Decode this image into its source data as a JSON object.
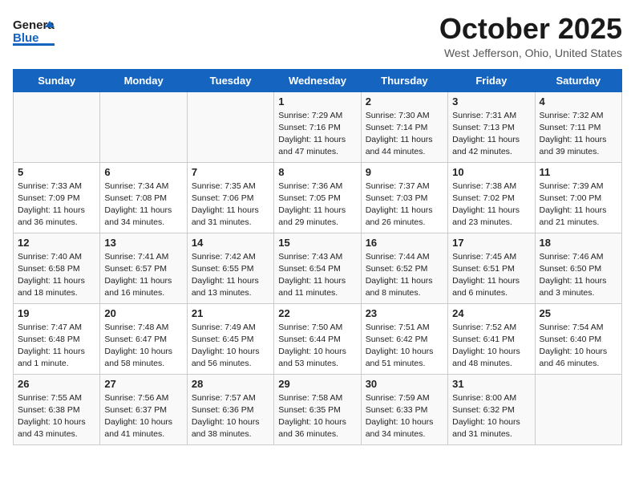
{
  "header": {
    "logo_line1": "General",
    "logo_line2": "Blue",
    "month": "October 2025",
    "location": "West Jefferson, Ohio, United States"
  },
  "days_of_week": [
    "Sunday",
    "Monday",
    "Tuesday",
    "Wednesday",
    "Thursday",
    "Friday",
    "Saturday"
  ],
  "weeks": [
    [
      {
        "day": "",
        "detail": ""
      },
      {
        "day": "",
        "detail": ""
      },
      {
        "day": "",
        "detail": ""
      },
      {
        "day": "1",
        "detail": "Sunrise: 7:29 AM\nSunset: 7:16 PM\nDaylight: 11 hours\nand 47 minutes."
      },
      {
        "day": "2",
        "detail": "Sunrise: 7:30 AM\nSunset: 7:14 PM\nDaylight: 11 hours\nand 44 minutes."
      },
      {
        "day": "3",
        "detail": "Sunrise: 7:31 AM\nSunset: 7:13 PM\nDaylight: 11 hours\nand 42 minutes."
      },
      {
        "day": "4",
        "detail": "Sunrise: 7:32 AM\nSunset: 7:11 PM\nDaylight: 11 hours\nand 39 minutes."
      }
    ],
    [
      {
        "day": "5",
        "detail": "Sunrise: 7:33 AM\nSunset: 7:09 PM\nDaylight: 11 hours\nand 36 minutes."
      },
      {
        "day": "6",
        "detail": "Sunrise: 7:34 AM\nSunset: 7:08 PM\nDaylight: 11 hours\nand 34 minutes."
      },
      {
        "day": "7",
        "detail": "Sunrise: 7:35 AM\nSunset: 7:06 PM\nDaylight: 11 hours\nand 31 minutes."
      },
      {
        "day": "8",
        "detail": "Sunrise: 7:36 AM\nSunset: 7:05 PM\nDaylight: 11 hours\nand 29 minutes."
      },
      {
        "day": "9",
        "detail": "Sunrise: 7:37 AM\nSunset: 7:03 PM\nDaylight: 11 hours\nand 26 minutes."
      },
      {
        "day": "10",
        "detail": "Sunrise: 7:38 AM\nSunset: 7:02 PM\nDaylight: 11 hours\nand 23 minutes."
      },
      {
        "day": "11",
        "detail": "Sunrise: 7:39 AM\nSunset: 7:00 PM\nDaylight: 11 hours\nand 21 minutes."
      }
    ],
    [
      {
        "day": "12",
        "detail": "Sunrise: 7:40 AM\nSunset: 6:58 PM\nDaylight: 11 hours\nand 18 minutes."
      },
      {
        "day": "13",
        "detail": "Sunrise: 7:41 AM\nSunset: 6:57 PM\nDaylight: 11 hours\nand 16 minutes."
      },
      {
        "day": "14",
        "detail": "Sunrise: 7:42 AM\nSunset: 6:55 PM\nDaylight: 11 hours\nand 13 minutes."
      },
      {
        "day": "15",
        "detail": "Sunrise: 7:43 AM\nSunset: 6:54 PM\nDaylight: 11 hours\nand 11 minutes."
      },
      {
        "day": "16",
        "detail": "Sunrise: 7:44 AM\nSunset: 6:52 PM\nDaylight: 11 hours\nand 8 minutes."
      },
      {
        "day": "17",
        "detail": "Sunrise: 7:45 AM\nSunset: 6:51 PM\nDaylight: 11 hours\nand 6 minutes."
      },
      {
        "day": "18",
        "detail": "Sunrise: 7:46 AM\nSunset: 6:50 PM\nDaylight: 11 hours\nand 3 minutes."
      }
    ],
    [
      {
        "day": "19",
        "detail": "Sunrise: 7:47 AM\nSunset: 6:48 PM\nDaylight: 11 hours\nand 1 minute."
      },
      {
        "day": "20",
        "detail": "Sunrise: 7:48 AM\nSunset: 6:47 PM\nDaylight: 10 hours\nand 58 minutes."
      },
      {
        "day": "21",
        "detail": "Sunrise: 7:49 AM\nSunset: 6:45 PM\nDaylight: 10 hours\nand 56 minutes."
      },
      {
        "day": "22",
        "detail": "Sunrise: 7:50 AM\nSunset: 6:44 PM\nDaylight: 10 hours\nand 53 minutes."
      },
      {
        "day": "23",
        "detail": "Sunrise: 7:51 AM\nSunset: 6:42 PM\nDaylight: 10 hours\nand 51 minutes."
      },
      {
        "day": "24",
        "detail": "Sunrise: 7:52 AM\nSunset: 6:41 PM\nDaylight: 10 hours\nand 48 minutes."
      },
      {
        "day": "25",
        "detail": "Sunrise: 7:54 AM\nSunset: 6:40 PM\nDaylight: 10 hours\nand 46 minutes."
      }
    ],
    [
      {
        "day": "26",
        "detail": "Sunrise: 7:55 AM\nSunset: 6:38 PM\nDaylight: 10 hours\nand 43 minutes."
      },
      {
        "day": "27",
        "detail": "Sunrise: 7:56 AM\nSunset: 6:37 PM\nDaylight: 10 hours\nand 41 minutes."
      },
      {
        "day": "28",
        "detail": "Sunrise: 7:57 AM\nSunset: 6:36 PM\nDaylight: 10 hours\nand 38 minutes."
      },
      {
        "day": "29",
        "detail": "Sunrise: 7:58 AM\nSunset: 6:35 PM\nDaylight: 10 hours\nand 36 minutes."
      },
      {
        "day": "30",
        "detail": "Sunrise: 7:59 AM\nSunset: 6:33 PM\nDaylight: 10 hours\nand 34 minutes."
      },
      {
        "day": "31",
        "detail": "Sunrise: 8:00 AM\nSunset: 6:32 PM\nDaylight: 10 hours\nand 31 minutes."
      },
      {
        "day": "",
        "detail": ""
      }
    ]
  ]
}
